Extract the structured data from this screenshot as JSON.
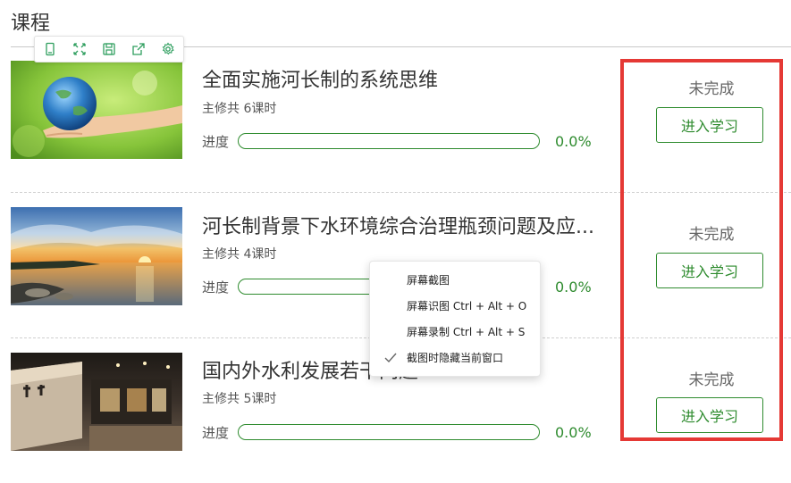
{
  "page": {
    "title": "课程"
  },
  "mini_toolbar": {
    "icons": [
      "tablet-icon",
      "fullscreen-icon",
      "save-icon",
      "share-icon",
      "settings-icon"
    ]
  },
  "courses": [
    {
      "title": "全面实施河长制的系统思维",
      "meta": "主修共 6课时",
      "progress_label": "进度",
      "progress_percent": "0.0%",
      "progress_value": 0,
      "status": "未完成",
      "enter_label": "进入学习",
      "thumbnail": "earth-in-hand-image"
    },
    {
      "title": "河长制背景下水环境综合治理瓶颈问题及应...",
      "meta": "主修共 4课时",
      "progress_label": "进度",
      "progress_percent": "0.0%",
      "progress_value": 0,
      "status": "未完成",
      "enter_label": "进入学习",
      "thumbnail": "lake-sunset-image"
    },
    {
      "title": "国内外水利发展若干问题",
      "meta": "主修共 5课时",
      "progress_label": "进度",
      "progress_percent": "0.0%",
      "progress_value": 0,
      "status": "未完成",
      "enter_label": "进入学习",
      "thumbnail": "water-museum-image"
    }
  ],
  "context_menu": {
    "items": [
      {
        "label": "屏幕截图",
        "checked": false
      },
      {
        "label": "屏幕识图 Ctrl + Alt + O",
        "checked": false
      },
      {
        "label": "屏幕录制 Ctrl + Alt + S",
        "checked": false
      },
      {
        "label": "截图时隐藏当前窗口",
        "checked": true
      }
    ]
  },
  "colors": {
    "accent": "#2e8b2e",
    "highlight": "#e53935",
    "text": "#333333"
  }
}
